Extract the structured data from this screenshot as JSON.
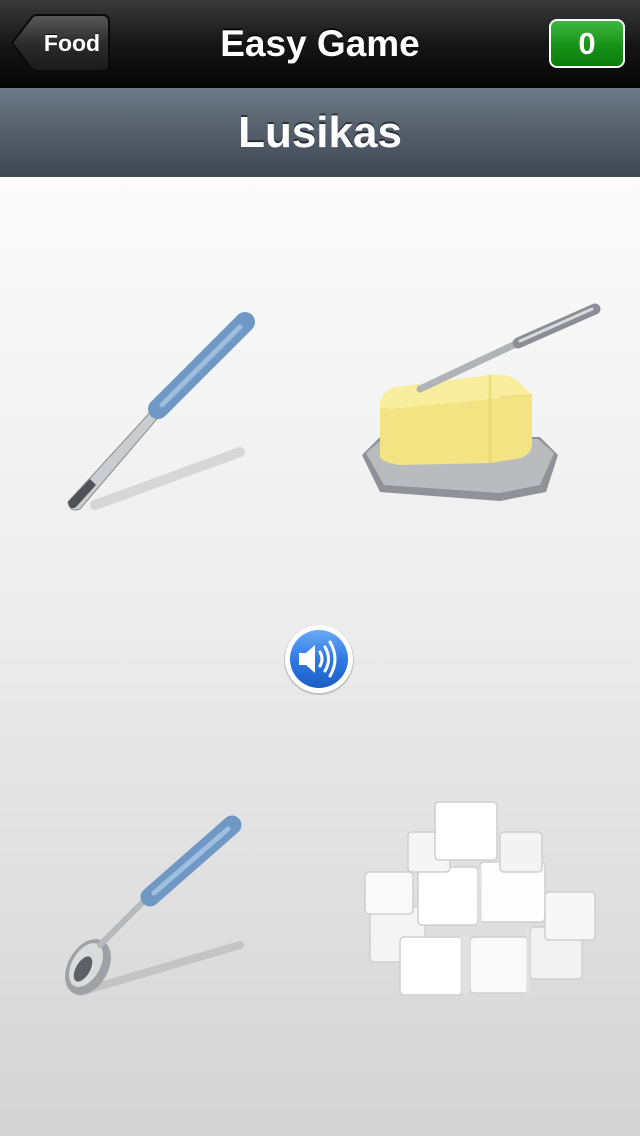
{
  "navbar": {
    "back_label": "Food",
    "title": "Easy Game",
    "score": "0",
    "colors": {
      "bar": "#111111",
      "score_green": "#179217"
    }
  },
  "prompt": {
    "word": "Lusikas",
    "bar_color": "#56616d"
  },
  "choices": [
    {
      "name": "knife",
      "icon": "knife-image"
    },
    {
      "name": "butter",
      "icon": "butter-image"
    },
    {
      "name": "spoon",
      "icon": "spoon-image"
    },
    {
      "name": "sugar",
      "icon": "sugar-cubes-image"
    }
  ],
  "audio_button": {
    "icon": "speaker-icon",
    "color": "#2f7ae5"
  }
}
